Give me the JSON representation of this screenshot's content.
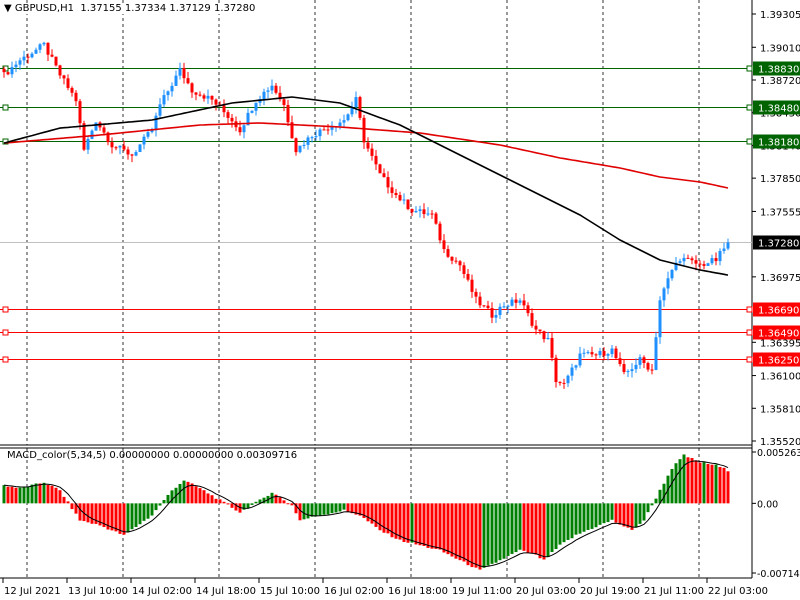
{
  "header": {
    "symbol": "GBPUSD,H1",
    "open": "1.37155",
    "high": "1.37334",
    "low": "1.37129",
    "close": "1.37280"
  },
  "colors": {
    "bull": "#1e90ff",
    "bear": "#ff0000",
    "ma_fast": "#000000",
    "ma_slow": "#e00000",
    "macd_up": "#008000",
    "macd_down": "#ff0000",
    "level_green": "#006400",
    "level_red": "#ff0000"
  },
  "chart_data": [
    {
      "type": "candlestick",
      "title": "GBPUSD,H1",
      "total_bars": 182,
      "ylim": [
        1.3552,
        1.39305
      ],
      "y_ticks": [
        "1.39305",
        "1.39010",
        "1.38720",
        "1.38430",
        "1.38140",
        "1.37850",
        "1.37555",
        "1.36975",
        "1.36395",
        "1.36100",
        "1.35810",
        "1.35520"
      ],
      "x_ticks": [
        "12 Jul 2021",
        "13 Jul 10:00",
        "14 Jul 02:00",
        "14 Jul 18:00",
        "15 Jul 10:00",
        "16 Jul 02:00",
        "16 Jul 18:00",
        "19 Jul 11:00",
        "20 Jul 03:00",
        "20 Jul 19:00",
        "21 Jul 11:00",
        "22 Jul 03:00"
      ],
      "close_path": [
        [
          0,
          1.38764
        ],
        [
          4,
          1.38897
        ],
        [
          10,
          1.3903
        ],
        [
          14,
          1.38764
        ],
        [
          18,
          1.38543
        ],
        [
          20,
          1.38099
        ],
        [
          23,
          1.38365
        ],
        [
          27,
          1.38144
        ],
        [
          32,
          1.38055
        ],
        [
          37,
          1.38277
        ],
        [
          39,
          1.38498
        ],
        [
          44,
          1.38809
        ],
        [
          47,
          1.38631
        ],
        [
          52,
          1.38543
        ],
        [
          57,
          1.38365
        ],
        [
          59,
          1.38277
        ],
        [
          63,
          1.38543
        ],
        [
          67,
          1.38676
        ],
        [
          70,
          1.38498
        ],
        [
          73,
          1.38099
        ],
        [
          77,
          1.38232
        ],
        [
          82,
          1.38321
        ],
        [
          85,
          1.38365
        ],
        [
          88,
          1.38543
        ],
        [
          90,
          1.38188
        ],
        [
          94,
          1.37878
        ],
        [
          98,
          1.37701
        ],
        [
          102,
          1.37568
        ],
        [
          107,
          1.37523
        ],
        [
          110,
          1.37213
        ],
        [
          114,
          1.3708
        ],
        [
          118,
          1.3677
        ],
        [
          122,
          1.36637
        ],
        [
          125,
          1.36725
        ],
        [
          129,
          1.3677
        ],
        [
          133,
          1.36504
        ],
        [
          136,
          1.36415
        ],
        [
          138,
          1.36061
        ],
        [
          140,
          1.36016
        ],
        [
          144,
          1.36282
        ],
        [
          148,
          1.36282
        ],
        [
          152,
          1.36327
        ],
        [
          155,
          1.36105
        ],
        [
          159,
          1.36238
        ],
        [
          162,
          1.36149
        ],
        [
          164,
          1.3677
        ],
        [
          167,
          1.37036
        ],
        [
          169,
          1.37142
        ],
        [
          174,
          1.3708
        ],
        [
          178,
          1.37124
        ],
        [
          181,
          1.3728
        ]
      ],
      "ma_fast": [
        [
          0,
          1.38161
        ],
        [
          14,
          1.38294
        ],
        [
          37,
          1.38365
        ],
        [
          57,
          1.38516
        ],
        [
          72,
          1.38569
        ],
        [
          84,
          1.38516
        ],
        [
          99,
          1.38321
        ],
        [
          114,
          1.38055
        ],
        [
          129,
          1.37789
        ],
        [
          144,
          1.37523
        ],
        [
          154,
          1.37302
        ],
        [
          164,
          1.37124
        ],
        [
          174,
          1.37036
        ],
        [
          181,
          1.36991
        ]
      ],
      "ma_slow": [
        [
          0,
          1.38161
        ],
        [
          24,
          1.38232
        ],
        [
          49,
          1.38321
        ],
        [
          64,
          1.38339
        ],
        [
          84,
          1.38303
        ],
        [
          104,
          1.3825
        ],
        [
          124,
          1.38144
        ],
        [
          139,
          1.38029
        ],
        [
          154,
          1.3794
        ],
        [
          164,
          1.3786
        ],
        [
          174,
          1.37816
        ],
        [
          181,
          1.37763
        ]
      ],
      "levels": [
        {
          "price": "1.38830",
          "color": "green"
        },
        {
          "price": "1.38480",
          "color": "green"
        },
        {
          "price": "1.38180",
          "color": "green"
        },
        {
          "price": "1.36690",
          "color": "red"
        },
        {
          "price": "1.36490",
          "color": "red"
        },
        {
          "price": "1.36250",
          "color": "red"
        }
      ],
      "current_price": "1.37280"
    },
    {
      "type": "bar",
      "title": "MACD_color(5,34,5) 0.00000000 0.00000000 0.00309716",
      "ylim": [
        -0.007141,
        0.0052633
      ],
      "y_ticks": [
        "0.0052633",
        "0.00",
        "-0.007141"
      ],
      "macd_path": [
        [
          0,
          0.00185
        ],
        [
          4,
          0.00154
        ],
        [
          10,
          0.00215
        ],
        [
          14,
          0.00133
        ],
        [
          19,
          -0.00174
        ],
        [
          24,
          -0.00226
        ],
        [
          30,
          -0.00328
        ],
        [
          37,
          -0.00123
        ],
        [
          42,
          0.00133
        ],
        [
          45,
          0.00236
        ],
        [
          49,
          0.00154
        ],
        [
          54,
          0.00031
        ],
        [
          59,
          -0.00092
        ],
        [
          64,
          0.00031
        ],
        [
          67,
          0.00113
        ],
        [
          72,
          -0.00021
        ],
        [
          74,
          -0.00174
        ],
        [
          79,
          -0.00123
        ],
        [
          85,
          -0.00072
        ],
        [
          89,
          -0.00123
        ],
        [
          94,
          -0.00277
        ],
        [
          99,
          -0.00379
        ],
        [
          104,
          -0.00431
        ],
        [
          109,
          -0.00482
        ],
        [
          114,
          -0.00585
        ],
        [
          119,
          -0.00687
        ],
        [
          124,
          -0.00585
        ],
        [
          129,
          -0.00482
        ],
        [
          133,
          -0.00533
        ],
        [
          135,
          -0.00585
        ],
        [
          139,
          -0.00431
        ],
        [
          143,
          -0.00328
        ],
        [
          147,
          -0.00256
        ],
        [
          152,
          -0.00174
        ],
        [
          157,
          -0.00277
        ],
        [
          160,
          -0.00174
        ],
        [
          164,
          0.00133
        ],
        [
          167,
          0.00359
        ],
        [
          170,
          0.00492
        ],
        [
          174,
          0.00421
        ],
        [
          178,
          0.0039
        ],
        [
          181,
          0.00338
        ]
      ]
    }
  ]
}
